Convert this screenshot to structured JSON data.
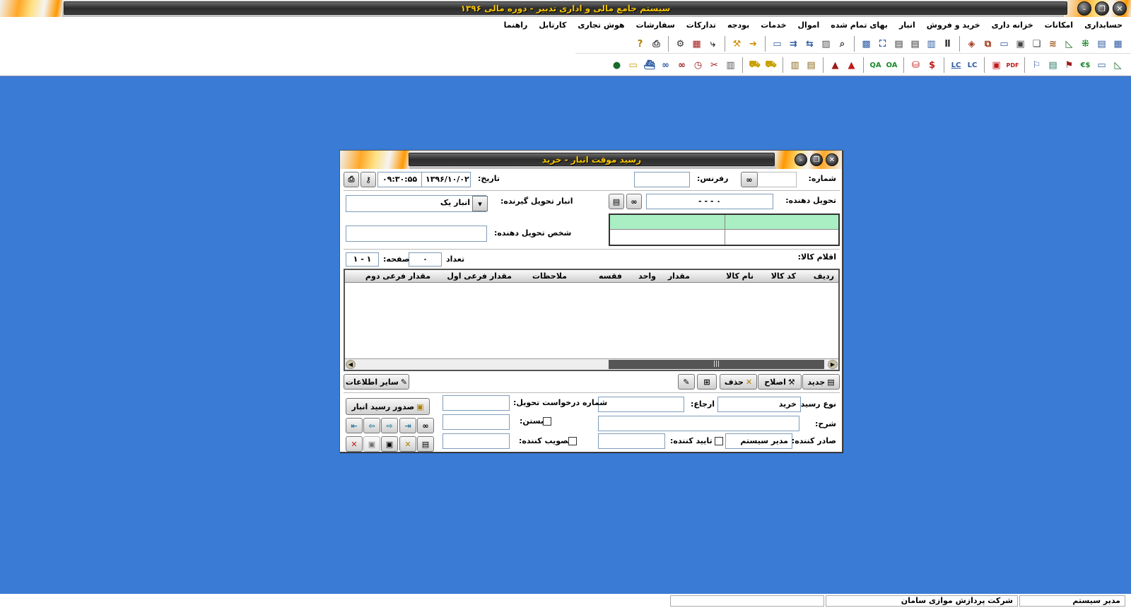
{
  "app": {
    "title": "سیستم جامع مالی و اداری تدبیر - دوره مالی ۱۳۹۶"
  },
  "menu": [
    "حسابداری",
    "امکانات",
    "خزانه داری",
    "خرید و فروش",
    "انبار",
    "بهای تمام شده",
    "اموال",
    "خدمات",
    "بودجه",
    "تدارکات",
    "سفارشات",
    "هوش تجاری",
    "کارتابل",
    "راهنما"
  ],
  "toolbar_icons_row1": [
    "grid-icon",
    "list-icon",
    "tree-icon",
    "chart-icon",
    "stack-icon",
    "copy-icon",
    "doc-icon",
    "window-icon",
    "windows-icon",
    "cube-icon",
    "sep",
    "columns-icon",
    "table-icon",
    "list2-icon",
    "list3-icon",
    "frame-icon",
    "image-icon",
    "sep",
    "search-icon",
    "doc2-icon",
    "arrows-icon",
    "merge-icon",
    "monitor-icon",
    "sep",
    "forward-icon",
    "tools-icon",
    "sep",
    "export-icon",
    "db-icon",
    "settings-icon",
    "sep",
    "print-icon",
    "help-icon"
  ],
  "toolbar_icons_row2": [
    "chart-up-icon",
    "screen-icon",
    "money-icon",
    "flag-icon",
    "pallet-icon",
    "sep",
    "pdf-icon",
    "pdf2-icon",
    "sep",
    "lc-text-icon",
    "lc-icon",
    "sep",
    "dollar-icon",
    "cash-icon",
    "sep",
    "oa-icon",
    "qa-icon",
    "sep",
    "pyramid-icon",
    "pyramid2-icon",
    "sep",
    "ledger-icon",
    "ledger2-icon",
    "sep",
    "truck-icon",
    "truck2-icon",
    "sep",
    "book-icon",
    "scissors-icon",
    "clock-icon",
    "binoculars-icon",
    "binoculars2-icon",
    "ship-icon",
    "bus-icon",
    "globe-icon"
  ],
  "toolbar_glyphs": {
    "dollar": "$",
    "cash": "$€",
    "oa": "OA",
    "qa": "QA",
    "lc": "LC",
    "lc_text": "LC",
    "pdf": "PDF",
    "help": "?"
  },
  "status": {
    "user": "مدیر سیستم",
    "company": "شرکت پردازش موازی سامان",
    "empty": ""
  },
  "dialog": {
    "title": "رسید موقت انبار - خرید",
    "number_label": "شماره:",
    "number_value": "",
    "reference_label": "رفرنس:",
    "reference_value": "",
    "date_label": "تاریخ:",
    "date_value": "۱۳۹۶/۱۰/۰۲",
    "time_value": "۰۹:۳۰:۵۵",
    "deliverer_label": "تحویل دهنده:",
    "deliverer_value": "- - - ۰",
    "receiving_warehouse_label": "انبار تحویل گیرنده:",
    "receiving_warehouse_value": "انبار یک",
    "delivering_person_label": "شخص تحویل دهنده:",
    "delivering_person_value": "",
    "items_label": "اقلام کالا:",
    "count_label": "تعداد",
    "count_value": "۰",
    "page_label": "صفحه:",
    "page_value": "۱ - ۱",
    "grid_columns": [
      "ردیف",
      "کد کالا",
      "نام کالا",
      "مقدار",
      "واحد",
      "فقسه",
      "ملاحظات",
      "مقدار فرعی اول",
      "مقدار فرعی دوم"
    ],
    "buttons": {
      "new": "جدید",
      "edit": "اصلاح",
      "delete": "حذف",
      "other_info": "سایر اطلاعات",
      "issue_receipt": "صدور رسید انبار"
    },
    "receipt_type_label": "نوع رسید:",
    "receipt_type_value": "خرید",
    "return_label": "ارجاع:",
    "return_value": "",
    "delivery_request_label": "شماره درخواست تحویل:",
    "delivery_request_value": "",
    "description_label": "شرح:",
    "description_value": "",
    "close_label": "بستن:",
    "issuer_label": "صادر کننده:",
    "issuer_value": "مدیر سیستم",
    "confirmer_label": "تایید کننده:",
    "confirmer_value": "",
    "approver_label": "تصویب کننده:",
    "approver_value": ""
  }
}
